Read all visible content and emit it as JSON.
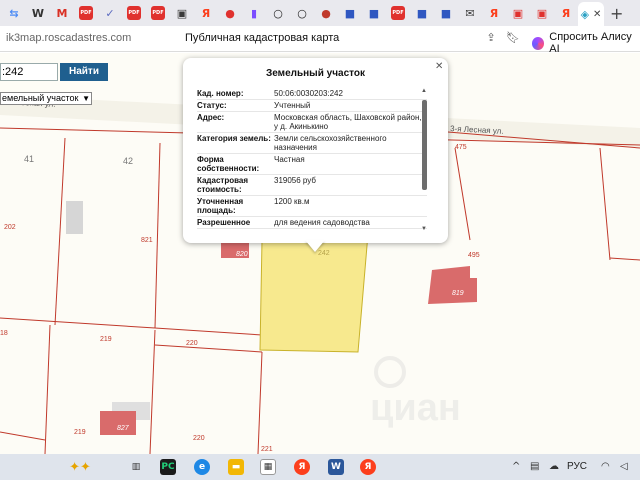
{
  "browser": {
    "tabs": [
      {
        "icon": "translate-icon",
        "glyph": "⇆",
        "color": "#4c8bf5"
      },
      {
        "icon": "wikipedia-icon",
        "glyph": "W",
        "color": "#333333"
      },
      {
        "icon": "gmail-icon",
        "glyph": "M",
        "color": "#d93025"
      },
      {
        "icon": "pdf-icon",
        "glyph": "PDF",
        "color": "#e0312e"
      },
      {
        "icon": "bird-icon",
        "glyph": "✓",
        "color": "#5c6bc0"
      },
      {
        "icon": "pdf-icon",
        "glyph": "PDF",
        "color": "#e0312e"
      },
      {
        "icon": "pdf-icon",
        "glyph": "PDF",
        "color": "#e0312e"
      },
      {
        "icon": "square-icon",
        "glyph": "▣",
        "color": "#3a3a3a"
      },
      {
        "icon": "yandex-icon",
        "glyph": "Я",
        "color": "#fc3f1d"
      },
      {
        "icon": "red-dot-icon",
        "glyph": "●",
        "color": "#e0312e"
      },
      {
        "icon": "stats-icon",
        "glyph": "▮",
        "color": "#7c4dff"
      },
      {
        "icon": "ring-icon",
        "glyph": "○",
        "color": "#222222"
      },
      {
        "icon": "ring-icon",
        "glyph": "○",
        "color": "#222222"
      },
      {
        "icon": "avatar-icon",
        "glyph": "●",
        "color": "#c0392b"
      },
      {
        "icon": "flag-ru-icon",
        "glyph": "■",
        "color": "#2f57c1"
      },
      {
        "icon": "flag-ru-icon",
        "glyph": "■",
        "color": "#2f57c1"
      },
      {
        "icon": "pdf-icon",
        "glyph": "PDF",
        "color": "#e0312e"
      },
      {
        "icon": "flag-ru-icon",
        "glyph": "■",
        "color": "#2f57c1"
      },
      {
        "icon": "flag-ru-icon",
        "glyph": "■",
        "color": "#2f57c1"
      },
      {
        "icon": "mail-icon",
        "glyph": "✉",
        "color": "#3a3a3a"
      },
      {
        "icon": "yandex-icon",
        "glyph": "Я",
        "color": "#fc3f1d"
      },
      {
        "icon": "record-icon",
        "glyph": "▣",
        "color": "#e0312e"
      },
      {
        "icon": "record-icon",
        "glyph": "▣",
        "color": "#e0312e"
      },
      {
        "icon": "yandex-icon",
        "glyph": "Я",
        "color": "#fc3f1d"
      }
    ],
    "url": "ik3map.roscadastres.com",
    "page_title": "Публичная кадастровая карта",
    "alisa_label": "Спросить Алису AI"
  },
  "search": {
    "value": ":242",
    "button_label": "Найти",
    "select_value": "емельный участок"
  },
  "map": {
    "street_label_left": "3-я Лесная ул.",
    "street_label_right": "3-я Лесная ул.",
    "plot_numbers": {
      "p41": "41",
      "p42": "42",
      "p202": "202",
      "p821": "821",
      "p820": "820",
      "p242": "242",
      "p475": "475",
      "p495": "495",
      "p819": "819",
      "p18": "18",
      "p219a": "219",
      "p220a": "220",
      "p219b": "219",
      "p827": "827",
      "p220b": "220",
      "p221": "221"
    },
    "watermark": "циан"
  },
  "popup": {
    "title": "Земельный участок",
    "rows": [
      {
        "k": "Кад. номер:",
        "v": "50:06:0030203:242"
      },
      {
        "k": "Статус:",
        "v": "Учтенный"
      },
      {
        "k": "Адрес:",
        "v": "Московская область, Шаховской район, у д. Акинькино"
      },
      {
        "k": "Категория земель:",
        "v": "Земли сельскохозяйственного назначения"
      },
      {
        "k": "Форма собственности:",
        "v": "Частная"
      },
      {
        "k": "Кадастровая стоимость:",
        "v": "319056 руб"
      },
      {
        "k": "Уточненная площадь:",
        "v": "1200 кв.м"
      },
      {
        "k": "Разрешенное",
        "v": "для ведения садоводства"
      }
    ]
  },
  "taskbar": {
    "tray_lang": "РУС"
  },
  "colors": {
    "plot_line": "#c0392b",
    "highlight_fill": "#f7e98e",
    "building_fill": "#d96b6b",
    "search_btn": "#1f5f8f"
  }
}
